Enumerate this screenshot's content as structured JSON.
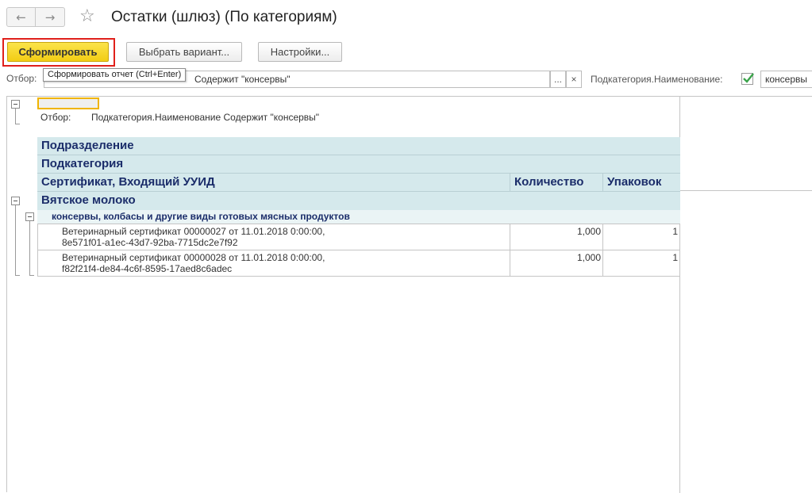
{
  "header": {
    "back_icon": "←",
    "forward_icon": "→",
    "star_icon": "☆",
    "title": "Остатки (шлюз) (По категориям)"
  },
  "toolbar": {
    "generate_label": "Сформировать",
    "choose_variant_label": "Выбрать вариант...",
    "settings_label": "Настройки...",
    "tooltip": "Сформировать отчет (Ctrl+Enter)"
  },
  "filter": {
    "label": "Отбор:",
    "value": "Содержит \"консервы\"",
    "more_button": "...",
    "clear_button": "×",
    "subcategory_label": "Подкатегория.Наименование:",
    "subcategory_checked": true,
    "subcategory_value": "консервы"
  },
  "report": {
    "filter_caption": "Отбор:",
    "filter_text": "Подкатегория.Наименование Содержит \"консервы\"",
    "headers": {
      "division": "Подразделение",
      "subcategory": "Подкатегория",
      "certificate": "Сертификат, Входящий УУИД",
      "quantity": "Количество",
      "packages": "Упаковок"
    },
    "groups": [
      {
        "name": "Вятское молоко",
        "subgroups": [
          {
            "name": "консервы, колбасы и другие виды готовых мясных продуктов",
            "rows": [
              {
                "line1": "Ветеринарный сертификат 00000027 от 11.01.2018 0:00:00,",
                "line2": "8e571f01-a1ec-43d7-92ba-7715dc2e7f92",
                "quantity": "1,000",
                "packages": "1"
              },
              {
                "line1": "Ветеринарный сертификат 00000028 от 11.01.2018 0:00:00,",
                "line2": "f82f21f4-de84-4c6f-8595-17aed8c6adec",
                "quantity": "1,000",
                "packages": "1"
              }
            ]
          }
        ]
      }
    ]
  },
  "colors": {
    "accent_button": "#f2cd14",
    "highlight_outline": "#e0201b",
    "header_bg": "#d5e9ec",
    "header_text": "#1b2d6a"
  }
}
